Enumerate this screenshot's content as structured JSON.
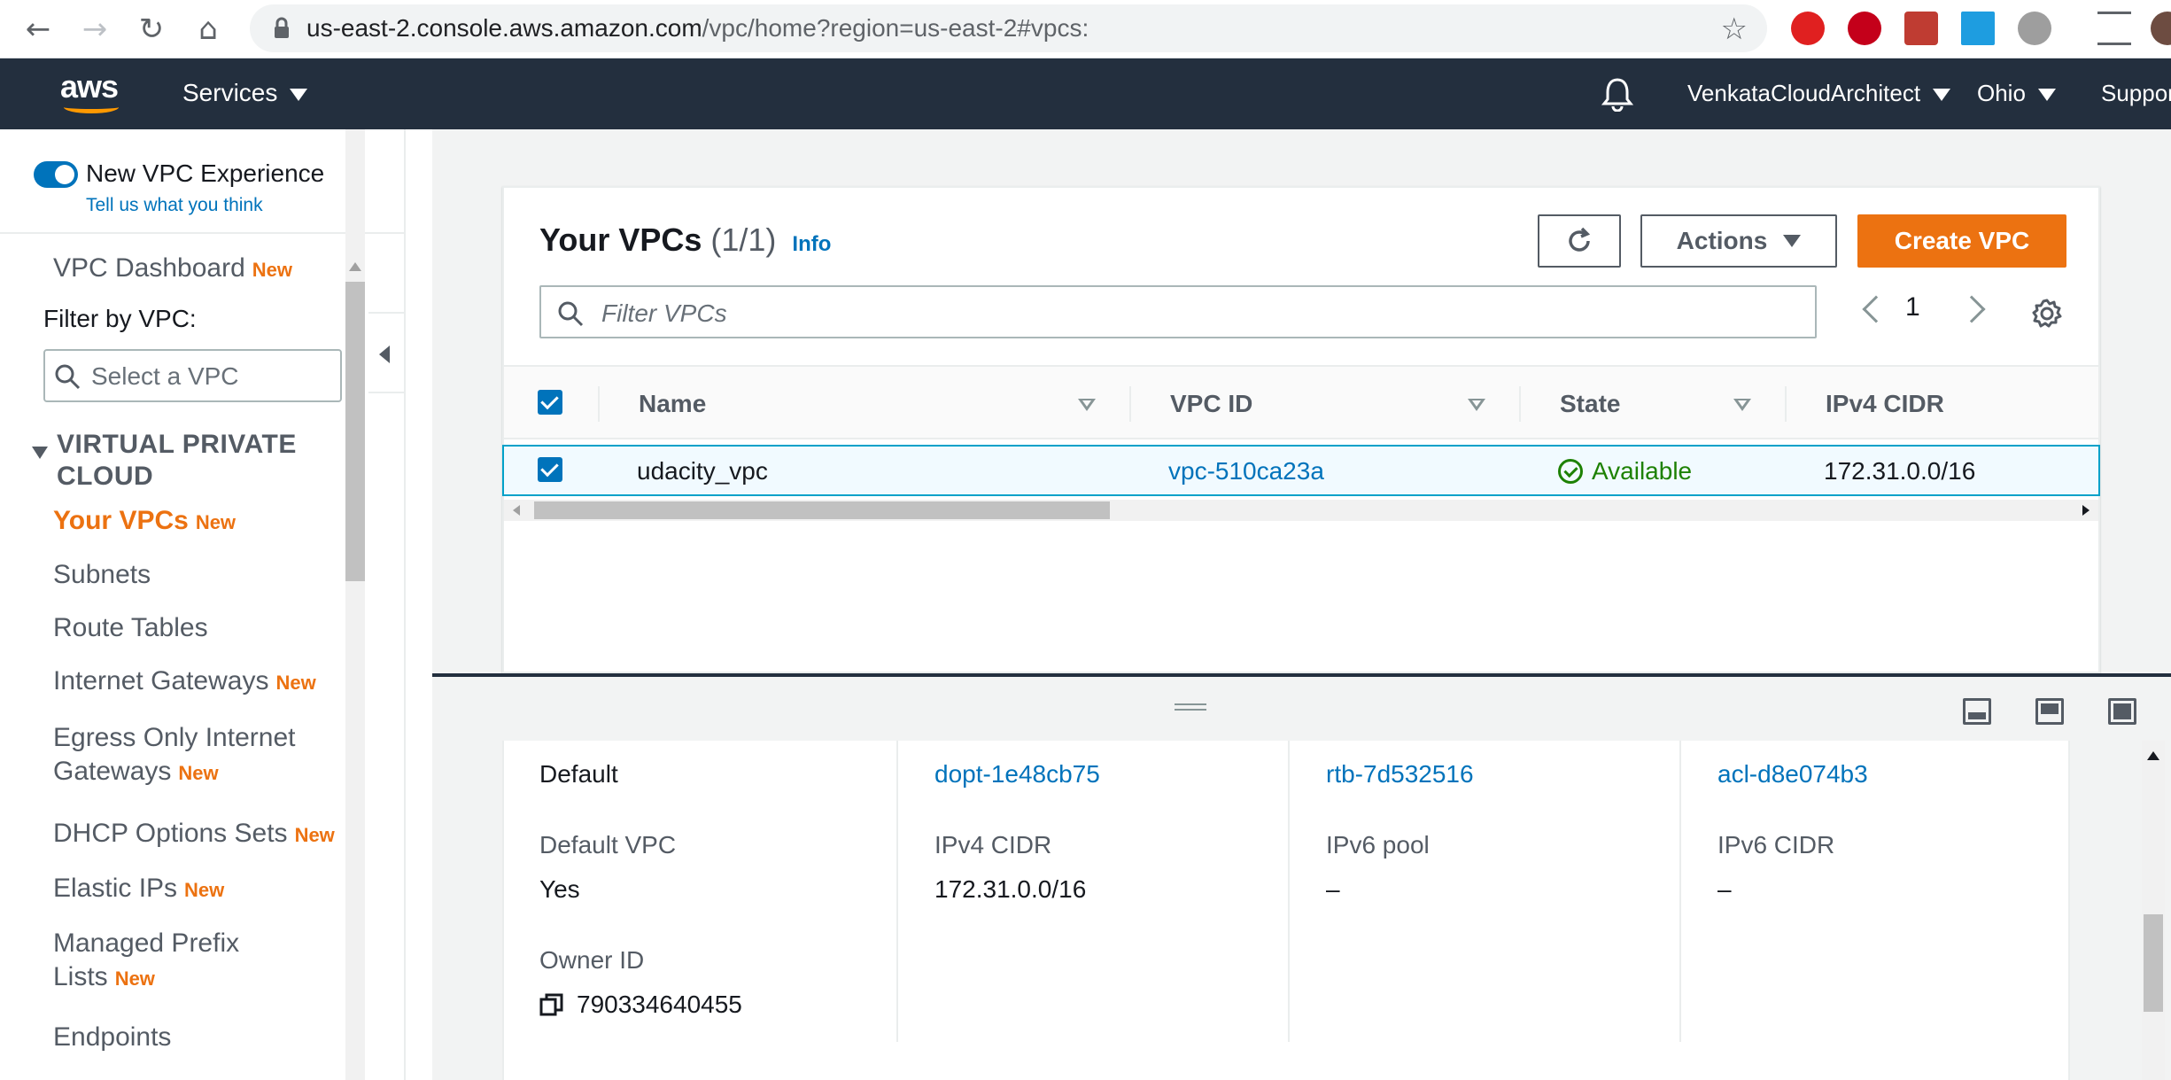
{
  "browser": {
    "url_host": "us-east-2.console.aws.amazon.com",
    "url_path": "/vpc/home?region=us-east-2#vpcs:"
  },
  "awsnav": {
    "services": "Services",
    "account": "VenkataCloudArchitect",
    "region": "Ohio",
    "support": "Support"
  },
  "sidebar": {
    "new_experience": "New VPC Experience",
    "feedback": "Tell us what you think",
    "filter_label": "Filter by VPC:",
    "filter_placeholder": "Select a VPC",
    "section": "VIRTUAL PRIVATE CLOUD",
    "badge": "New",
    "items": [
      {
        "label": "VPC Dashboard",
        "new": "New"
      },
      {
        "label": "Your VPCs",
        "new": "New"
      },
      {
        "label": "Subnets"
      },
      {
        "label": "Route Tables"
      },
      {
        "label": "Internet Gateways",
        "new": "New"
      },
      {
        "label": "Egress Only Internet",
        "label2": "Gateways",
        "new": "New"
      },
      {
        "label": "DHCP Options Sets",
        "new": "New"
      },
      {
        "label": "Elastic IPs",
        "new": "New"
      },
      {
        "label": "Managed Prefix",
        "label2": "Lists",
        "new": "New"
      },
      {
        "label": "Endpoints"
      }
    ]
  },
  "panel": {
    "title": "Your VPCs",
    "count": "(1/1)",
    "info": "Info",
    "actions": "Actions",
    "create": "Create VPC",
    "filter_placeholder": "Filter VPCs",
    "page": "1",
    "columns": [
      "Name",
      "VPC ID",
      "State",
      "IPv4 CIDR"
    ],
    "row": {
      "name": "udacity_vpc",
      "vpc_id": "vpc-510ca23a",
      "state": "Available",
      "cidr": "172.31.0.0/16"
    }
  },
  "details": {
    "row1": [
      "Default",
      "dopt-1e48cb75",
      "rtb-7d532516",
      "acl-d8e074b3"
    ],
    "labels2": [
      "Default VPC",
      "IPv4 CIDR",
      "IPv6 pool",
      "IPv6 CIDR"
    ],
    "values2": [
      "Yes",
      "172.31.0.0/16",
      "–",
      "–"
    ],
    "owner_label": "Owner ID",
    "owner_value": "790334640455"
  },
  "colors": {
    "accent": "#ec7211",
    "link": "#0073bb",
    "nav_bg": "#232f3e",
    "success": "#1d8102"
  }
}
